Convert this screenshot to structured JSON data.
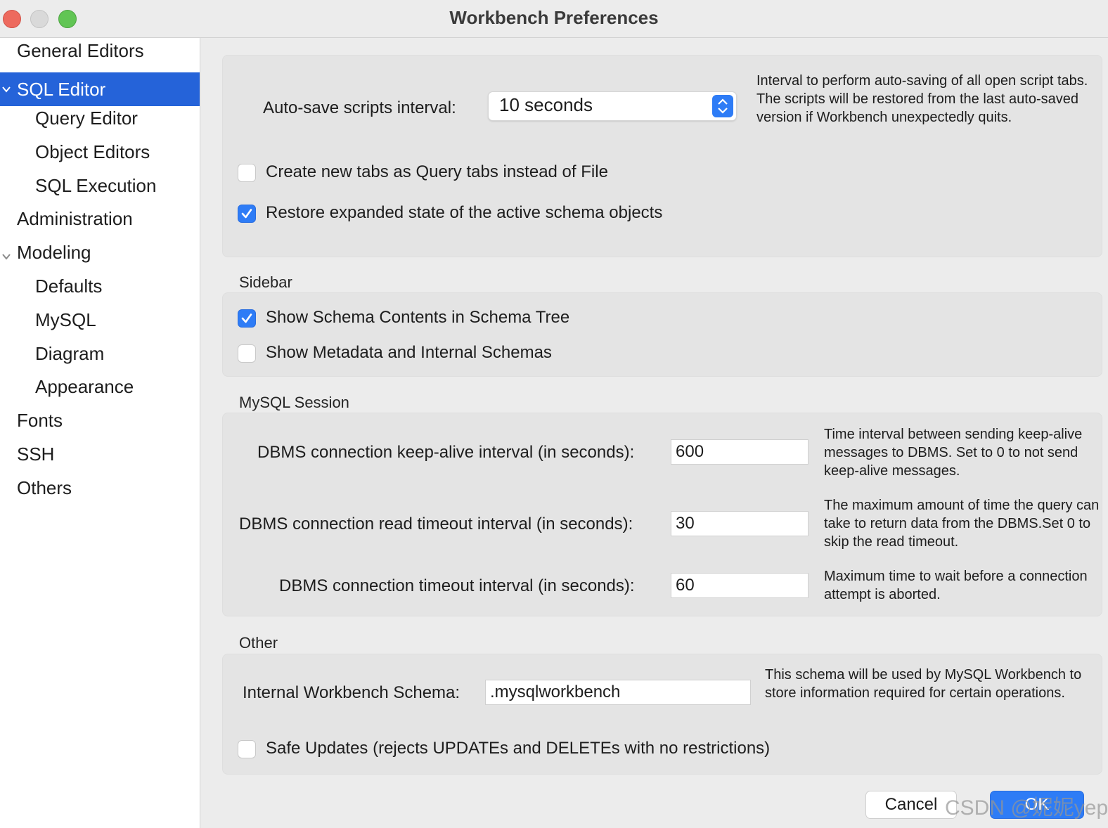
{
  "window": {
    "title": "Workbench Preferences"
  },
  "sidebar": {
    "items": [
      {
        "label": "General Editors"
      },
      {
        "label": "SQL Editor"
      },
      {
        "label": "Query Editor"
      },
      {
        "label": "Object Editors"
      },
      {
        "label": "SQL Execution"
      },
      {
        "label": "Administration"
      },
      {
        "label": "Modeling"
      },
      {
        "label": "Defaults"
      },
      {
        "label": "MySQL"
      },
      {
        "label": "Diagram"
      },
      {
        "label": "Appearance"
      },
      {
        "label": "Fonts"
      },
      {
        "label": "SSH"
      },
      {
        "label": "Others"
      }
    ],
    "selected": "SQL Editor"
  },
  "general": {
    "autosave_label": "Auto-save scripts interval:",
    "autosave_value": "10 seconds",
    "autosave_desc": "Interval to perform auto-saving of all open script tabs. The scripts will be restored from the last auto-saved version if Workbench unexpectedly quits.",
    "query_tabs_label": "Create new tabs as Query tabs instead of File",
    "query_tabs_checked": false,
    "restore_state_label": "Restore expanded state of the active schema objects",
    "restore_state_checked": true
  },
  "sidebar_section": {
    "title": "Sidebar",
    "show_schema_contents_label": "Show Schema Contents in Schema Tree",
    "show_schema_contents_checked": true,
    "show_metadata_label": "Show Metadata and Internal Schemas",
    "show_metadata_checked": false
  },
  "session": {
    "title": "MySQL Session",
    "keepalive_label": "DBMS connection keep-alive interval (in seconds):",
    "keepalive_value": "600",
    "keepalive_desc": "Time interval between sending keep-alive messages to DBMS. Set to 0 to not send keep-alive messages.",
    "read_timeout_label": "DBMS connection read timeout interval (in seconds):",
    "read_timeout_value": "30",
    "read_timeout_desc": "The maximum amount of time the query can take to return data from the DBMS.Set 0 to skip the read timeout.",
    "conn_timeout_label": "DBMS connection timeout interval (in seconds):",
    "conn_timeout_value": "60",
    "conn_timeout_desc": "Maximum time to wait before a connection attempt is aborted."
  },
  "other": {
    "title": "Other",
    "schema_label": "Internal Workbench Schema:",
    "schema_value": ".mysqlworkbench",
    "schema_desc": "This schema will be used by MySQL Workbench to store information required for certain operations.",
    "safe_updates_label": "Safe Updates (rejects UPDATEs and DELETEs with no restrictions)",
    "safe_updates_checked": false
  },
  "buttons": {
    "cancel": "Cancel",
    "ok": "OK"
  },
  "watermark": "CSDN @妮妮yep",
  "colors": {
    "accent": "#2e7cf6",
    "selection": "#2563d9"
  }
}
